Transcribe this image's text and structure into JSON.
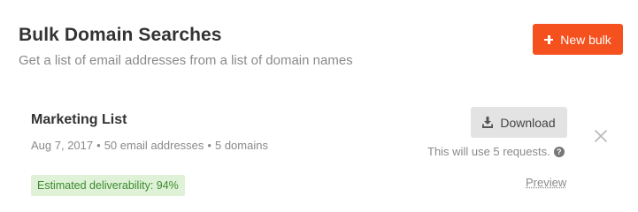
{
  "header": {
    "title": "Bulk Domain Searches",
    "subtitle": "Get a list of email addresses from a list of domain names",
    "new_bulk_label": "New bulk"
  },
  "bulk_item": {
    "name": "Marketing List",
    "date": "Aug 7, 2017",
    "emails": "50 email addresses",
    "domains": "5 domains",
    "separator": "•",
    "deliverability": "Estimated deliverability: 94%",
    "download_label": "Download",
    "requests_note": "This will use 5 requests.",
    "preview_label": "Preview"
  },
  "colors": {
    "accent": "#f4511e",
    "badge_bg": "#dff2d8",
    "badge_text": "#3c8a2e"
  },
  "icons": {
    "new_bulk": "plus-icon",
    "download": "download-icon",
    "help": "question-circle-icon",
    "close": "close-icon"
  }
}
